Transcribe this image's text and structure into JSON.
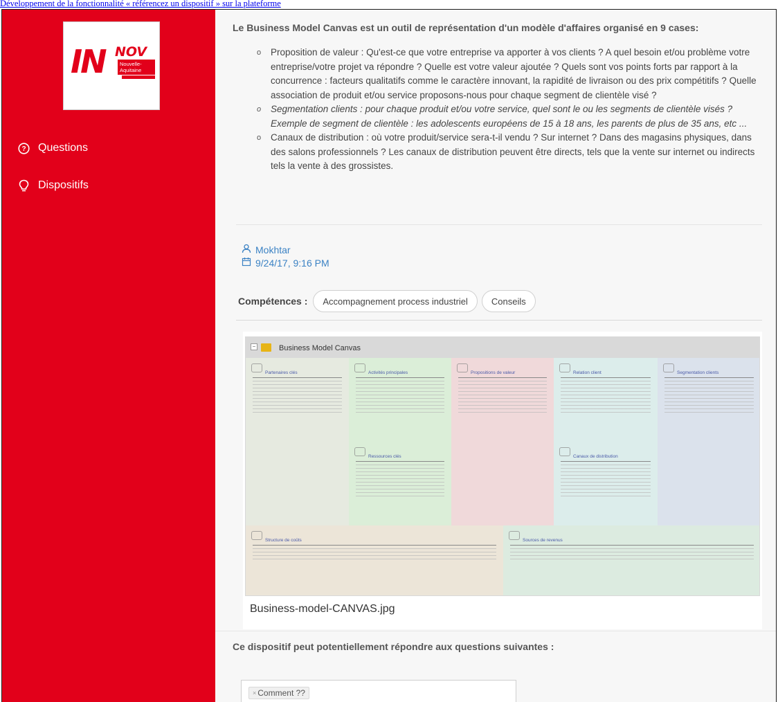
{
  "caption": "Développement de la fonctionnalité « référencez un dispositif » sur la plateforme",
  "sidebar": {
    "logo": {
      "main": "IN",
      "accent": "NOV",
      "sub": "Nouvelle-Aquitaine"
    },
    "items": [
      {
        "label": "Questions",
        "icon": "question-circle-icon"
      },
      {
        "label": "Dispositifs",
        "icon": "lightbulb-icon"
      }
    ],
    "color": "#e2001a"
  },
  "main": {
    "title": "Le Business Model Canvas est un outil de représentation d'un modèle d'affaires organisé en 9 cases:",
    "bullets": [
      "Proposition de valeur : Qu'est-ce que votre entreprise va apporter à vos clients ? A quel besoin et/ou problème votre entreprise/votre projet va répondre ? Quelle est votre valeur ajoutée ? Quels sont vos points forts par rapport à la concurrence : facteurs qualitatifs comme le caractère innovant, la rapidité de livraison ou des prix compétitifs ? Quelle association de produit et/ou service proposons-nous pour chaque segment de clientèle visé ?",
      "Segmentation clients : pour chaque produit et/ou votre service, quel sont le ou les segments de clientèle visés ? Exemple de segment de clientèle : les adolescents européens de 15 à 18 ans, les parents de plus de 35 ans, etc ...",
      "Canaux de distribution : où votre produit/service sera-t-il vendu ? Sur internet ? Dans des magasins physiques, dans des salons professionnels ?  Les canaux de distribution peuvent être directs, tels que la vente sur internet ou indirects tels la vente à des  grossistes."
    ],
    "author": "Mokhtar",
    "date": "9/24/17, 9:16 PM",
    "competences_label": "Compétences :",
    "competences": [
      "Accompagnement process industriel",
      "Conseils"
    ],
    "canvas": {
      "header": "Business Model Canvas",
      "cells": [
        "Partenaires clés",
        "Activités principales",
        "Propositions de valeur",
        "Relation client",
        "Segmentation clients",
        "Ressources clés",
        "Canaux de distribution",
        "Structure de coûts",
        "Sources de revenus"
      ],
      "filename": "Business-model-CANVAS.jpg"
    },
    "questions_title": "Ce dispositif peut potentiellement répondre aux questions suivantes :",
    "question_tags": [
      "Comment ??"
    ],
    "tag_remove": "×"
  }
}
